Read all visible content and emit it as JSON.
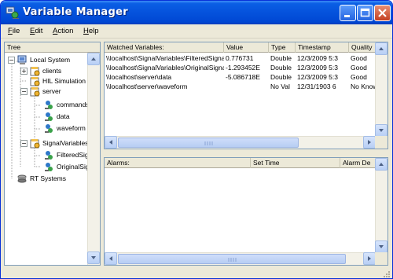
{
  "window": {
    "title": "Variable Manager"
  },
  "menu": [
    {
      "first": "F",
      "rest": "ile"
    },
    {
      "first": "E",
      "rest": "dit"
    },
    {
      "first": "A",
      "rest": "ction"
    },
    {
      "first": "H",
      "rest": "elp"
    }
  ],
  "tree": {
    "header": "Tree",
    "nodes": [
      {
        "label": "Local System",
        "icon": "computer-icon",
        "expander": "−"
      },
      {
        "label": "clients",
        "icon": "process-icon",
        "expander": "+"
      },
      {
        "label": "HIL Simulation",
        "icon": "process-icon",
        "expander": ""
      },
      {
        "label": "server",
        "icon": "process-icon",
        "expander": "−"
      },
      {
        "label": "commands",
        "icon": "variable-icon",
        "expander": ""
      },
      {
        "label": "data",
        "icon": "variable-icon",
        "expander": ""
      },
      {
        "label": "waveform",
        "icon": "variable-icon",
        "expander": ""
      },
      {
        "label": "SignalVariables",
        "icon": "process-icon",
        "expander": "−"
      },
      {
        "label": "FilteredSignal",
        "icon": "variable-icon",
        "expander": ""
      },
      {
        "label": "OriginalSignal",
        "icon": "variable-icon",
        "expander": ""
      },
      {
        "label": "RT Systems",
        "icon": "rt-systems-icon",
        "expander": ""
      }
    ]
  },
  "watched": {
    "columns": [
      "Watched Variables:",
      "Value",
      "Type",
      "Timestamp",
      "Quality"
    ],
    "rows": [
      [
        "\\\\localhost\\SignalVariables\\FilteredSignal",
        "0.776731",
        "Double",
        "12/3/2009 5:3",
        "Good"
      ],
      [
        "\\\\localhost\\SignalVariables\\OriginalSignal",
        "-1.293452E",
        "Double",
        "12/3/2009 5:3",
        "Good"
      ],
      [
        "\\\\localhost\\server\\data",
        "-5.086718E",
        "Double",
        "12/3/2009 5:3",
        "Good"
      ],
      [
        "\\\\localhost\\server\\waveform",
        "",
        "No Val",
        "12/31/1903 6",
        "No Known"
      ]
    ]
  },
  "alarms": {
    "columns": [
      "Alarms:",
      "Set Time",
      "Alarm De"
    ]
  }
}
